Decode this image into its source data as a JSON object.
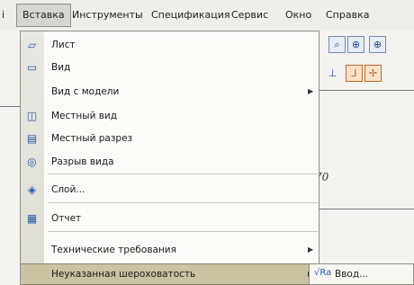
{
  "menubar": {
    "items": [
      "Вставка",
      "Инструменты",
      "Спецификация",
      "Сервис",
      "Окно",
      "Справка"
    ]
  },
  "menu": {
    "items": [
      {
        "label": "Лист",
        "icon": "sheet-icon"
      },
      {
        "label": "Вид",
        "icon": "view-icon"
      },
      {
        "label": "Вид с модели",
        "icon": "",
        "submenu": true
      },
      {
        "label": "Местный вид",
        "icon": "local-view-icon"
      },
      {
        "label": "Местный разрез",
        "icon": "local-section-icon"
      },
      {
        "label": "Разрыв вида",
        "icon": "view-break-icon"
      },
      {
        "label": "Слой...",
        "icon": "layer-icon"
      },
      {
        "label": "Отчет",
        "icon": "report-icon"
      },
      {
        "label": "Технические требования",
        "icon": "",
        "submenu": true
      },
      {
        "label": "Неуказанная шероховатость",
        "icon": "",
        "submenu": true,
        "highlighted": true
      }
    ]
  },
  "submenu": {
    "label": "Ввод..."
  },
  "drawing": {
    "value_label": "70"
  },
  "colors": {
    "highlight": "#c9c2a3",
    "menu_bg": "#fbfbf8",
    "menubar_bg": "#efeee9"
  }
}
